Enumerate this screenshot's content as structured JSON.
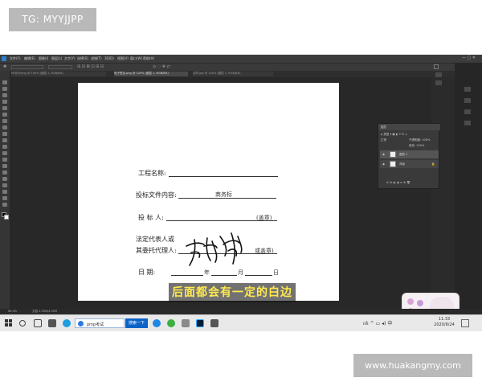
{
  "watermarks": {
    "telegram": "TG: MYYJJPP",
    "website": "www.huakangmy.com"
  },
  "photoshop": {
    "menus": [
      "文件(F)",
      "编辑(E)",
      "图像(I)",
      "图层(L)",
      "文字(Y)",
      "选择(S)",
      "滤镜(T)",
      "3D(D)",
      "视图(V)",
      "窗口(W)",
      "帮助(H)"
    ],
    "tabs": [
      "MYJJSP.png @ 100% (图层 1, RGB/8#)",
      "电子签名.png @ 125% (图层 1, RGB/8#)",
      "合同.jpg @ 100% (图层 1, RGB/8#)"
    ],
    "zoom": "66.4%",
    "doc_info": "文档:1.50M/4.00M"
  },
  "document": {
    "fields": [
      {
        "label": "工程名称:",
        "value": ""
      },
      {
        "label": "投标文件内容:",
        "value": "商务标"
      },
      {
        "label": "投  标  人:",
        "value": "",
        "suffix": "(盖章)"
      },
      {
        "label": "法定代表人或",
        "value": ""
      },
      {
        "label": "其委托代理人:",
        "value": "",
        "suffix": "或盖章)"
      },
      {
        "label": "日      期:",
        "value": "",
        "suffix_year": "年",
        "suffix_month": "月",
        "suffix_day": "日"
      }
    ],
    "signature_alt": "handwritten signature"
  },
  "layers_panel": {
    "title": "图层",
    "mode": "正常",
    "opacity": "不透明度: 100%",
    "fill": "填充: 100%",
    "layers": [
      "图层 1",
      "背景"
    ]
  },
  "subtitle": "后面都会有一定的白边",
  "taskbar": {
    "search_text": "pmp考试",
    "search_button": "搜索一下",
    "time": "11:33",
    "date": "2020/6/24"
  }
}
